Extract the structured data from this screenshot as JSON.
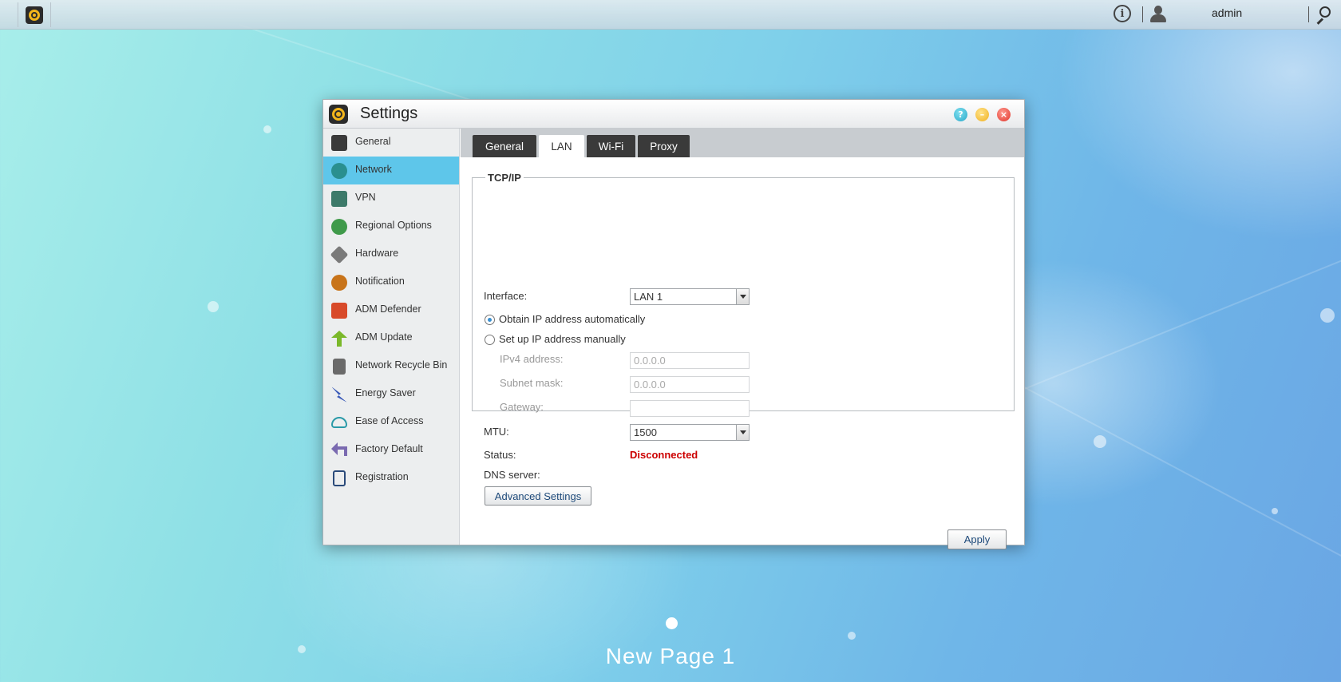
{
  "topbar": {
    "app_icon": "settings-gear-icon",
    "info_icon": "info-icon",
    "user_icon": "user-icon",
    "username": "admin",
    "search_icon": "search-icon"
  },
  "window": {
    "title": "Settings",
    "controls": [
      "help-icon",
      "minimize-icon",
      "close-icon"
    ]
  },
  "sidebar": {
    "items": [
      {
        "label": "General",
        "icon": "nas-icon",
        "color": "#3a3a3a"
      },
      {
        "label": "Network",
        "icon": "globe-icon",
        "color": "#2a8f8f",
        "active": true
      },
      {
        "label": "VPN",
        "icon": "vpn-icon",
        "color": "#3d7a6a"
      },
      {
        "label": "Regional Options",
        "icon": "globe-pin-icon",
        "color": "#3f9a4a"
      },
      {
        "label": "Hardware",
        "icon": "wrench-icon",
        "color": "#7a7a7a"
      },
      {
        "label": "Notification",
        "icon": "alert-icon",
        "color": "#c8741a"
      },
      {
        "label": "ADM Defender",
        "icon": "firewall-icon",
        "color": "#d84a2a"
      },
      {
        "label": "ADM Update",
        "icon": "arrow-up-icon",
        "color": "#7ab82a"
      },
      {
        "label": "Network Recycle Bin",
        "icon": "trash-icon",
        "color": "#6a6a6a"
      },
      {
        "label": "Energy Saver",
        "icon": "lightning-icon",
        "color": "#3a5ab8"
      },
      {
        "label": "Ease of Access",
        "icon": "cloud-upload-icon",
        "color": "#2a9aa8"
      },
      {
        "label": "Factory Default",
        "icon": "undo-icon",
        "color": "#7a6ab0"
      },
      {
        "label": "Registration",
        "icon": "clipboard-icon",
        "color": "#2a4a7a"
      }
    ]
  },
  "tabs": [
    {
      "label": "General"
    },
    {
      "label": "LAN",
      "active": true
    },
    {
      "label": "Wi-Fi"
    },
    {
      "label": "Proxy"
    }
  ],
  "tcpip": {
    "legend": "TCP/IP",
    "interface_label": "Interface:",
    "interface_value": "LAN 1",
    "radio_auto": "Obtain IP address automatically",
    "radio_manual": "Set up IP address manually",
    "ipv4_label": "IPv4 address:",
    "ipv4_value": "0.0.0.0",
    "subnet_label": "Subnet mask:",
    "subnet_value": "0.0.0.0",
    "gateway_label": "Gateway:",
    "gateway_value": "",
    "mtu_label": "MTU:",
    "mtu_value": "1500",
    "status_label": "Status:",
    "status_value": "Disconnected",
    "dns_label": "DNS server:",
    "advanced_button": "Advanced Settings"
  },
  "apply_button": "Apply",
  "desktop": {
    "page_label": "New Page 1"
  }
}
